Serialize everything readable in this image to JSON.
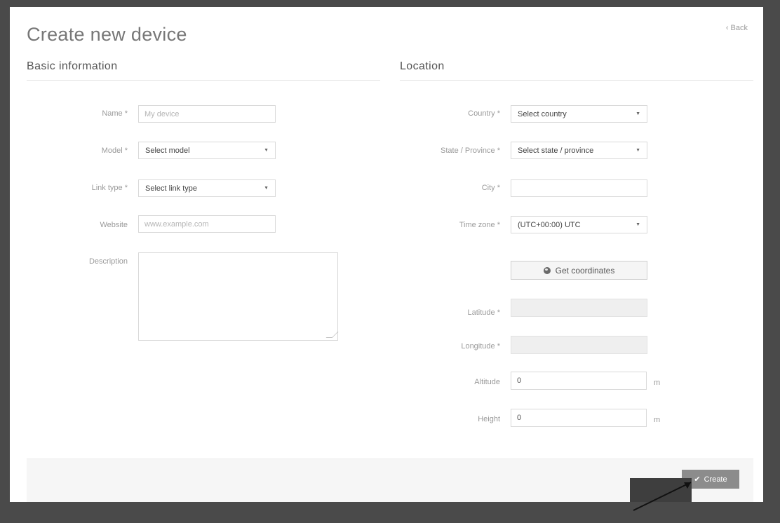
{
  "page": {
    "title": "Create new device",
    "back_label": "Back"
  },
  "basic": {
    "section_title": "Basic information",
    "name": {
      "label": "Name *",
      "placeholder": "My device",
      "value": ""
    },
    "model": {
      "label": "Model *",
      "selected": "Select model"
    },
    "link_type": {
      "label": "Link type *",
      "selected": "Select link type"
    },
    "website": {
      "label": "Website",
      "placeholder": "www.example.com",
      "value": ""
    },
    "description": {
      "label": "Description",
      "value": ""
    }
  },
  "location": {
    "section_title": "Location",
    "country": {
      "label": "Country *",
      "selected": "Select country"
    },
    "state": {
      "label": "State / Province *",
      "selected": "Select state / province"
    },
    "city": {
      "label": "City *",
      "value": ""
    },
    "time_zone": {
      "label": "Time zone *",
      "selected": "(UTC+00:00) UTC"
    },
    "get_coords_label": "Get coordinates",
    "latitude": {
      "label": "Latitude *",
      "value": ""
    },
    "longitude": {
      "label": "Longitude *",
      "value": ""
    },
    "altitude": {
      "label": "Altitude",
      "value": "0",
      "unit": "m"
    },
    "height": {
      "label": "Height",
      "value": "0",
      "unit": "m"
    }
  },
  "footer": {
    "create_label": "Create"
  },
  "icons": {
    "back": "chevron-left-icon",
    "globe": "globe-icon",
    "check": "check-icon",
    "caret": "caret-down-icon"
  },
  "colors": {
    "create_button": "#8c8c8c",
    "background_frame": "#4a4a4a"
  }
}
